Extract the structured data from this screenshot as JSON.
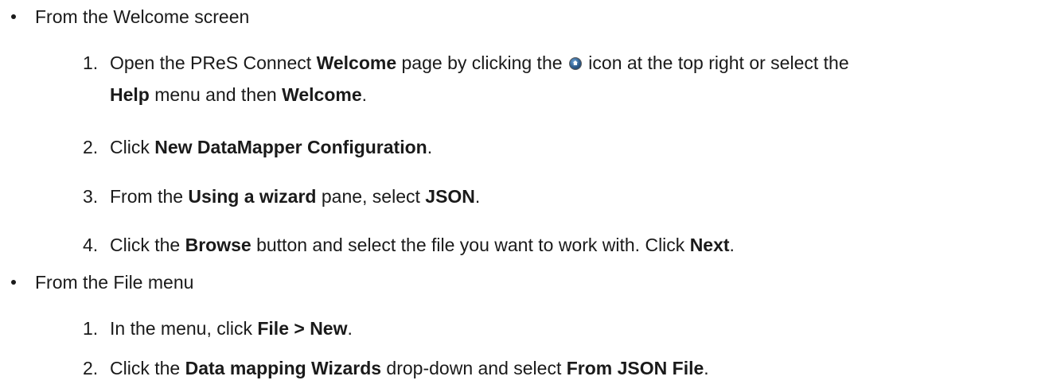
{
  "sections": [
    {
      "heading": "From the Welcome screen",
      "steps": [
        {
          "num": "1.",
          "t1": "Open the PReS Connect ",
          "b1": "Welcome",
          "t2": " page by clicking the ",
          "icon": "home-icon",
          "t3": " icon at the top right or select the",
          "b2": "Help",
          "t4": " menu and then ",
          "b3": "Welcome",
          "t5": "."
        },
        {
          "num": "2.",
          "t1": "Click ",
          "b1": "New DataMapper Configuration",
          "t2": "."
        },
        {
          "num": "3.",
          "t1": "From the ",
          "b1": "Using a wizard",
          "t2": " pane, select ",
          "b2": "JSON",
          "t3": "."
        },
        {
          "num": "4.",
          "t1": "Click the ",
          "b1": "Browse",
          "t2": " button and select the file you want to work with. Click ",
          "b2": "Next",
          "t3": "."
        }
      ]
    },
    {
      "heading": "From the File menu",
      "steps": [
        {
          "num": "1.",
          "t1": "In the menu, click ",
          "b1": "File > New",
          "t2": "."
        },
        {
          "num": "2.",
          "t1": "Click the ",
          "b1": "Data mapping Wizards",
          "t2": " drop-down and select ",
          "b2": "From JSON File",
          "t3": "."
        }
      ]
    }
  ]
}
